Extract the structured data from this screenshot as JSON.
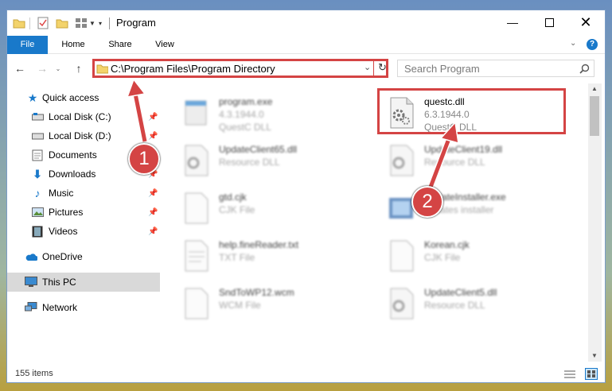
{
  "window": {
    "title": "Program"
  },
  "ribbon": {
    "tabs": [
      "File",
      "Home",
      "Share",
      "View"
    ]
  },
  "address": {
    "path": "C:\\Program Files\\Program Directory"
  },
  "search": {
    "placeholder": "Search Program"
  },
  "nav": {
    "items": [
      {
        "label": "Quick access",
        "icon": "star-icon",
        "pinned": false
      },
      {
        "label": "Local Disk (C:)",
        "icon": "drive-icon",
        "pinned": true
      },
      {
        "label": "Local Disk (D:)",
        "icon": "drive-icon",
        "pinned": true
      },
      {
        "label": "Documents",
        "icon": "documents-icon",
        "pinned": true
      },
      {
        "label": "Downloads",
        "icon": "download-icon",
        "pinned": true
      },
      {
        "label": "Music",
        "icon": "music-icon",
        "pinned": true
      },
      {
        "label": "Pictures",
        "icon": "pictures-icon",
        "pinned": true
      },
      {
        "label": "Videos",
        "icon": "videos-icon",
        "pinned": true
      },
      {
        "label": "OneDrive",
        "icon": "cloud-icon",
        "pinned": false
      },
      {
        "label": "This PC",
        "icon": "pc-icon",
        "pinned": false
      },
      {
        "label": "Network",
        "icon": "network-icon",
        "pinned": false
      }
    ]
  },
  "files": [
    {
      "name": "program.exe",
      "line1": "4.3.1944.0",
      "line2": "QuestC DLL",
      "blurred": true
    },
    {
      "name": "questc.dll",
      "line1": "6.3.1944.0",
      "line2": "QuestC DLL",
      "blurred": false
    },
    {
      "name": "UpdateClient65.dll",
      "line1": "Resource DLL",
      "line2": "",
      "blurred": true
    },
    {
      "name": "UpdateClient19.dll",
      "line1": "Resource DLL",
      "line2": "",
      "blurred": true
    },
    {
      "name": "gtd.cjk",
      "line1": "CJK File",
      "line2": "",
      "blurred": true
    },
    {
      "name": "UpdateInstaller.exe",
      "line1": "updates installer",
      "line2": "",
      "blurred": true
    },
    {
      "name": "help.fineReader.txt",
      "line1": "TXT File",
      "line2": "",
      "blurred": true
    },
    {
      "name": "Korean.cjk",
      "line1": "CJK File",
      "line2": "",
      "blurred": true
    },
    {
      "name": "SndToWP12.wcm",
      "line1": "WCM File",
      "line2": "",
      "blurred": true
    },
    {
      "name": "UpdateClient5.dll",
      "line1": "Resource DLL",
      "line2": "",
      "blurred": true
    }
  ],
  "status": {
    "count": "155 items"
  },
  "markers": [
    "1",
    "2"
  ],
  "colors": {
    "accent": "#1979ca",
    "highlight": "#d44444"
  }
}
